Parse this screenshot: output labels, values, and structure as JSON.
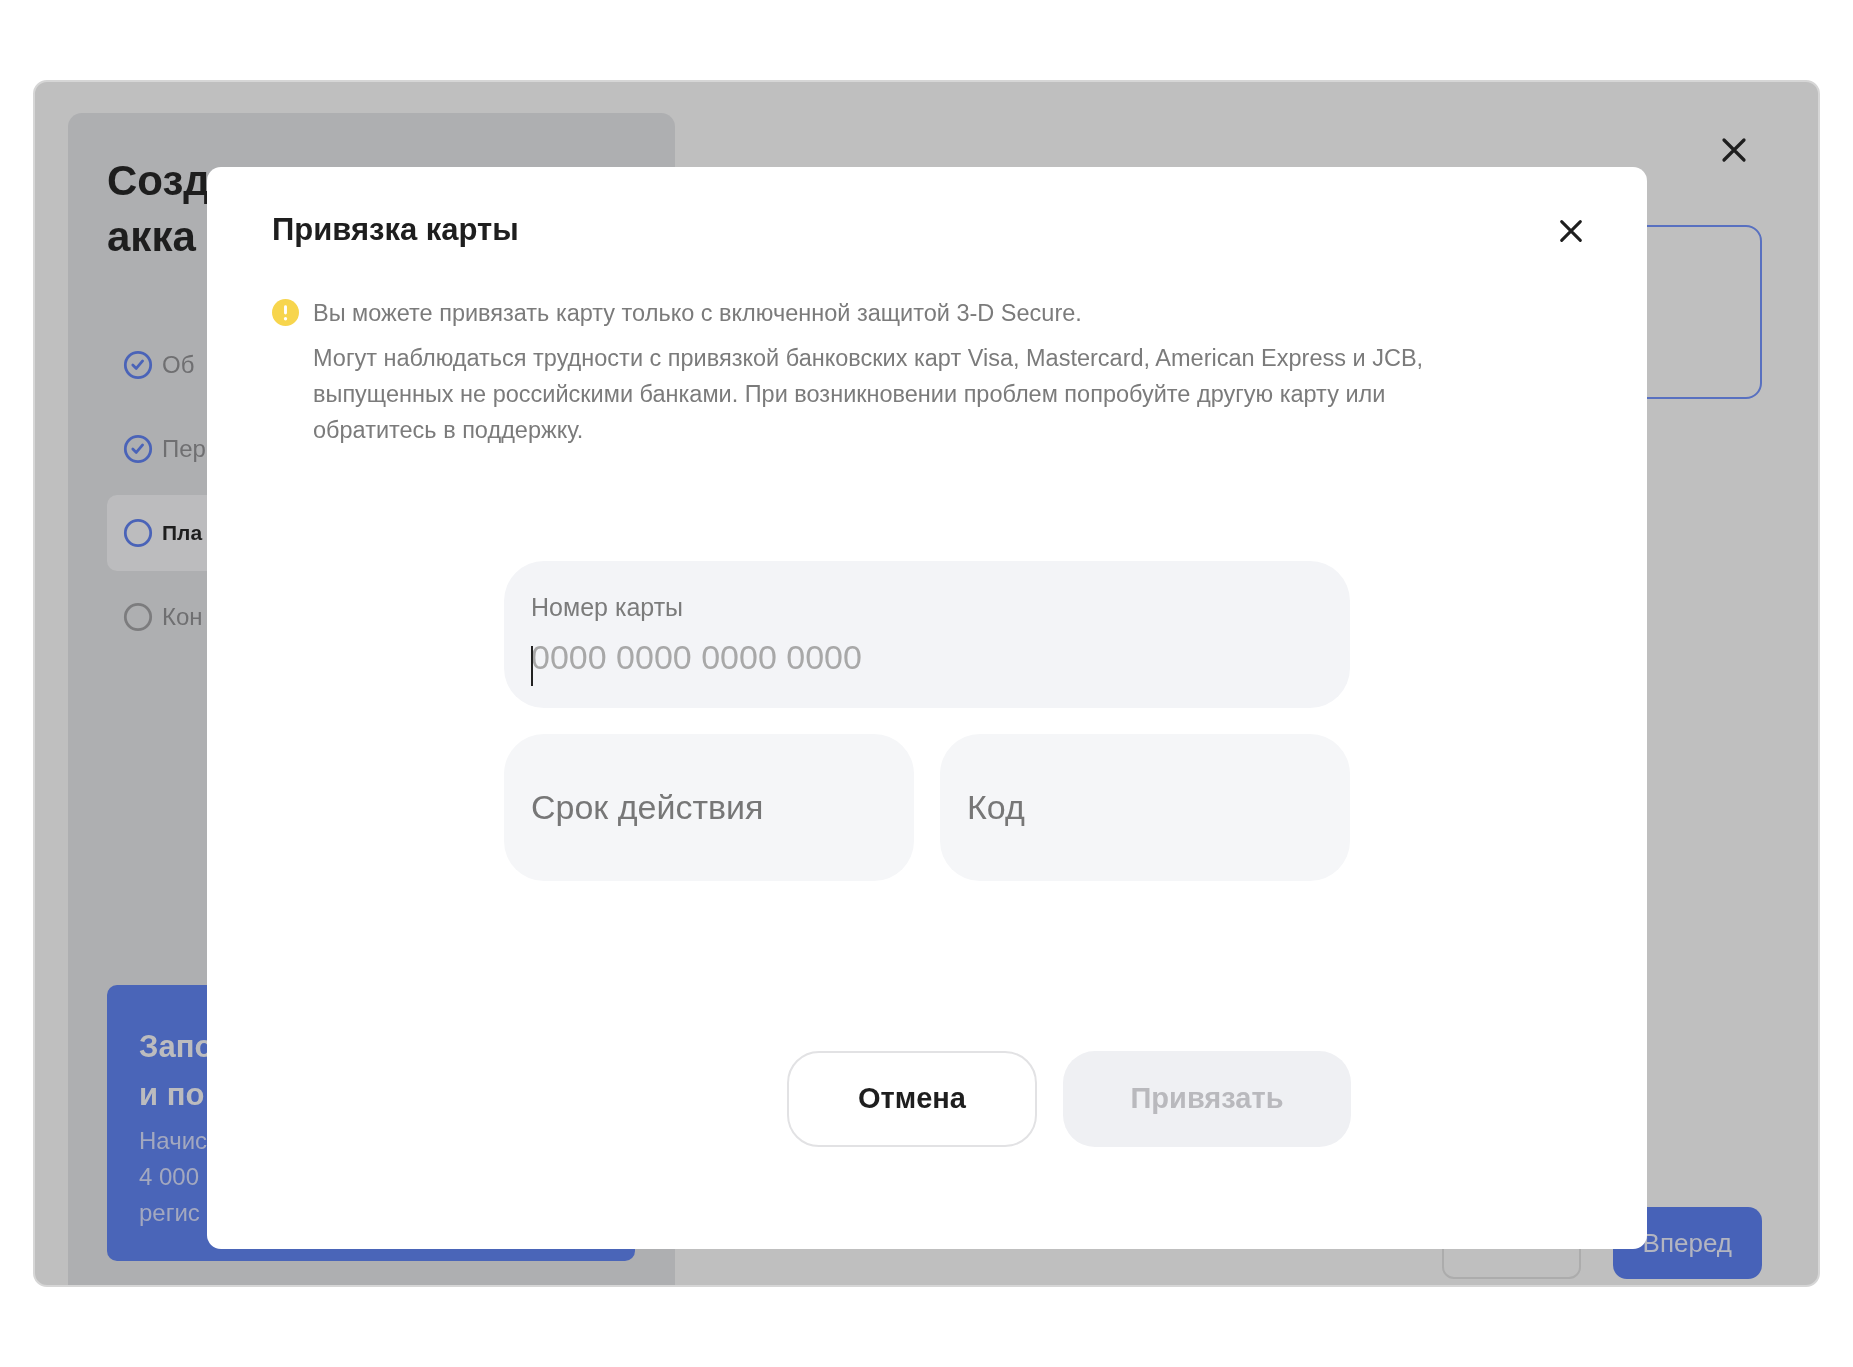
{
  "background": {
    "title_lines": [
      "Созд",
      "акка"
    ],
    "steps": [
      {
        "label": "Об",
        "completed": true,
        "selected": false
      },
      {
        "label": "Пер",
        "completed": true,
        "selected": false
      },
      {
        "label": "Пла",
        "completed": false,
        "selected": true
      },
      {
        "label": "Кон",
        "completed": false,
        "selected": false
      }
    ],
    "promo": {
      "title_lines": [
        "Запо",
        "и по"
      ],
      "text_lines": [
        "Начис",
        "4 000",
        "регис"
      ]
    },
    "forward_button": "Вперед"
  },
  "dialog": {
    "title": "Привязка карты",
    "warning": "Вы можете привязать карту только с включенной защитой 3-D Secure.",
    "note": "Могут наблюдаться трудности с привязкой банковских карт Visa, Mastercard, American Express и JCB, выпущенных не российскими банками. При возникновении проблем попробуйте другую карту или обратитесь в поддержку.",
    "fields": [
      {
        "label": "Номер карты",
        "placeholder": "0000 0000 0000 0000",
        "focused": true
      },
      {
        "placeholder": "Срок действия",
        "focused": false
      },
      {
        "placeholder": "Код",
        "focused": false
      }
    ],
    "buttons": [
      {
        "label": "Отмена",
        "disabled": false
      },
      {
        "label": "Привязать",
        "disabled": true
      }
    ]
  }
}
